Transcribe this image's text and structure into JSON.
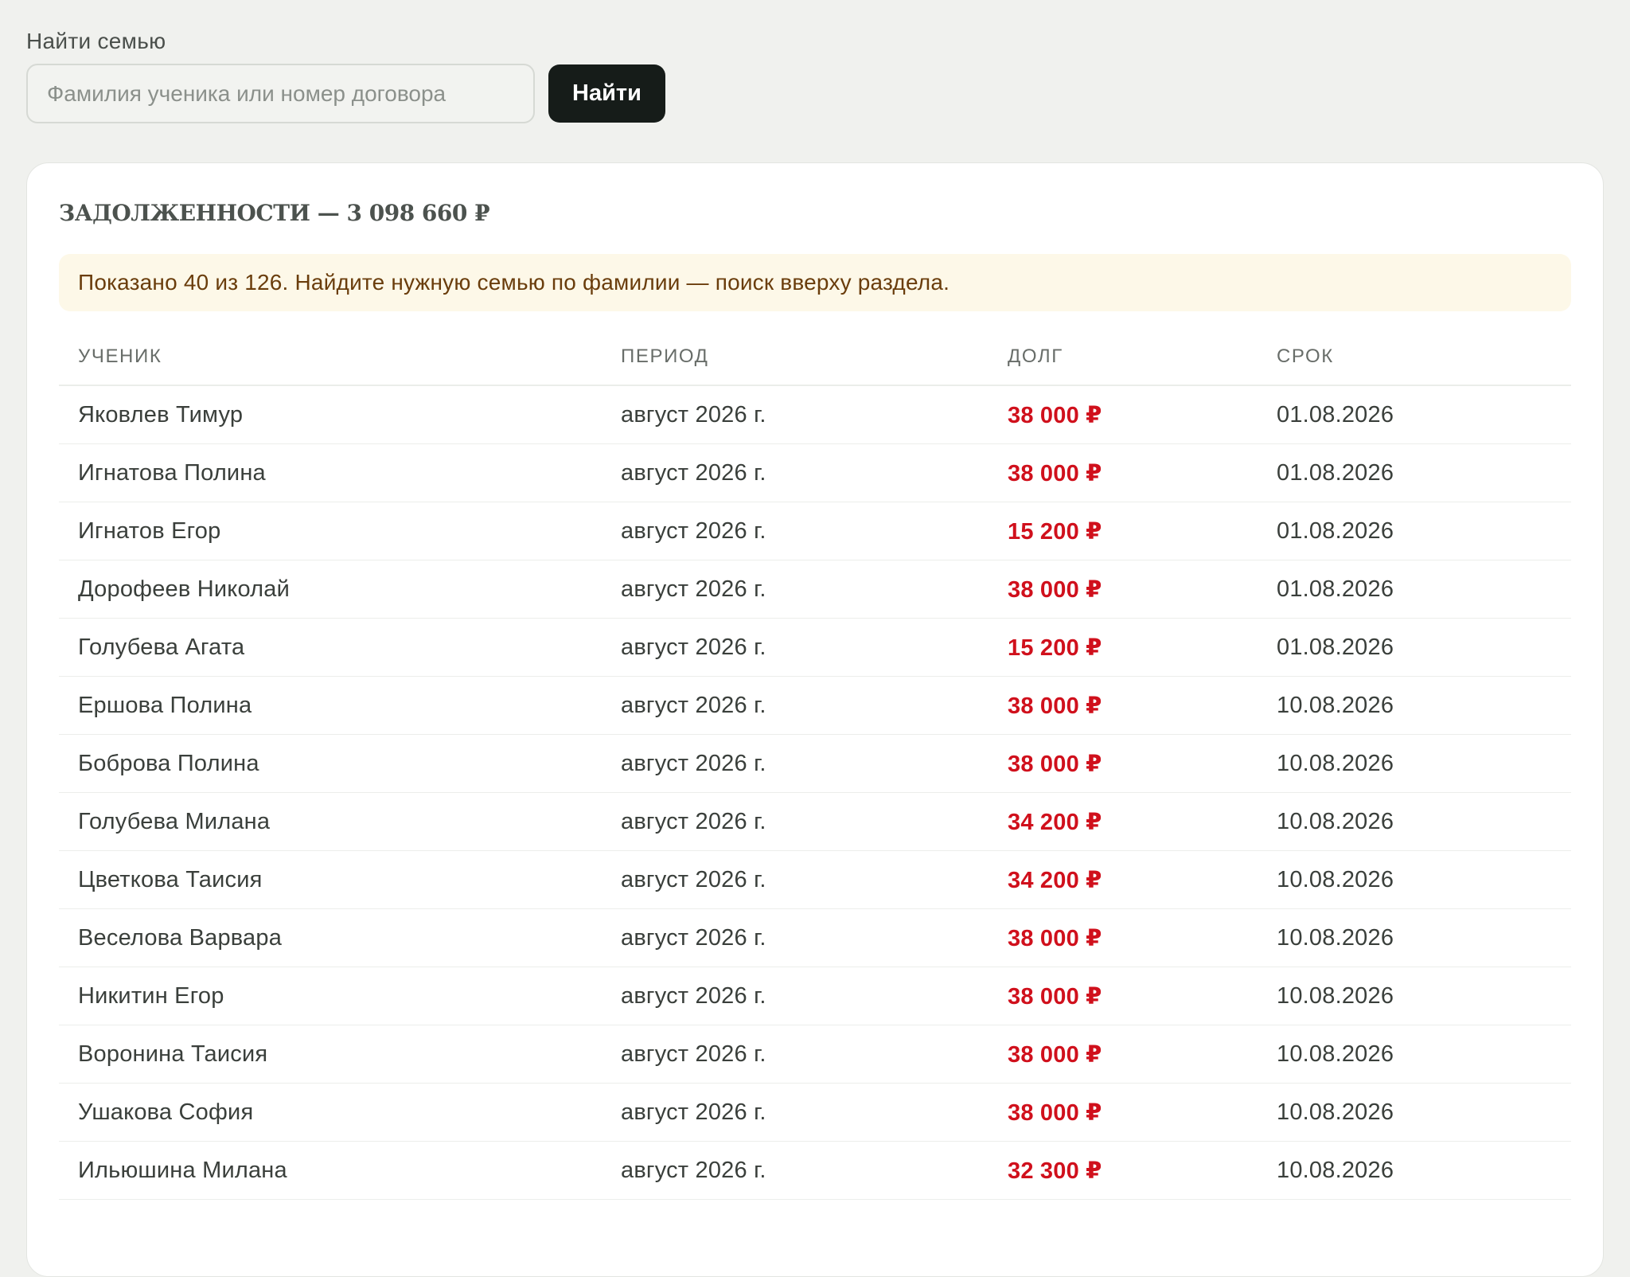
{
  "search": {
    "label": "Найти семью",
    "placeholder": "Фамилия ученика или номер договора",
    "value": "",
    "button_label": "Найти"
  },
  "debts": {
    "title": "ЗАДОЛЖЕННОСТИ — 3 098 660 ₽",
    "notice": "Показано 40 из 126. Найдите нужную семью по фамилии — поиск вверху раздела.",
    "columns": {
      "student": "УЧЕНИК",
      "period": "ПЕРИОД",
      "debt": "ДОЛГ",
      "due": "СРОК"
    },
    "rows": [
      {
        "student": "Яковлев Тимур",
        "period": "август 2026 г.",
        "debt": "38 000 ₽",
        "due": "01.08.2026"
      },
      {
        "student": "Игнатова Полина",
        "period": "август 2026 г.",
        "debt": "38 000 ₽",
        "due": "01.08.2026"
      },
      {
        "student": "Игнатов Егор",
        "period": "август 2026 г.",
        "debt": "15 200 ₽",
        "due": "01.08.2026"
      },
      {
        "student": "Дорофеев Николай",
        "period": "август 2026 г.",
        "debt": "38 000 ₽",
        "due": "01.08.2026"
      },
      {
        "student": "Голубева Агата",
        "period": "август 2026 г.",
        "debt": "15 200 ₽",
        "due": "01.08.2026"
      },
      {
        "student": "Ершова Полина",
        "period": "август 2026 г.",
        "debt": "38 000 ₽",
        "due": "10.08.2026"
      },
      {
        "student": "Боброва Полина",
        "period": "август 2026 г.",
        "debt": "38 000 ₽",
        "due": "10.08.2026"
      },
      {
        "student": "Голубева Милана",
        "period": "август 2026 г.",
        "debt": "34 200 ₽",
        "due": "10.08.2026"
      },
      {
        "student": "Цветкова Таисия",
        "period": "август 2026 г.",
        "debt": "34 200 ₽",
        "due": "10.08.2026"
      },
      {
        "student": "Веселова Варвара",
        "period": "август 2026 г.",
        "debt": "38 000 ₽",
        "due": "10.08.2026"
      },
      {
        "student": "Никитин Егор",
        "period": "август 2026 г.",
        "debt": "38 000 ₽",
        "due": "10.08.2026"
      },
      {
        "student": "Воронина Таисия",
        "period": "август 2026 г.",
        "debt": "38 000 ₽",
        "due": "10.08.2026"
      },
      {
        "student": "Ушакова София",
        "period": "август 2026 г.",
        "debt": "38 000 ₽",
        "due": "10.08.2026"
      },
      {
        "student": "Ильюшина Милана",
        "period": "август 2026 г.",
        "debt": "32 300 ₽",
        "due": "10.08.2026"
      }
    ]
  },
  "colors": {
    "background": "#f0f1ee",
    "card": "#ffffff",
    "button": "#161c19",
    "debt_accent": "#d0101c",
    "notice_bg": "#fdf8e8",
    "notice_text": "#6a3d0c"
  }
}
